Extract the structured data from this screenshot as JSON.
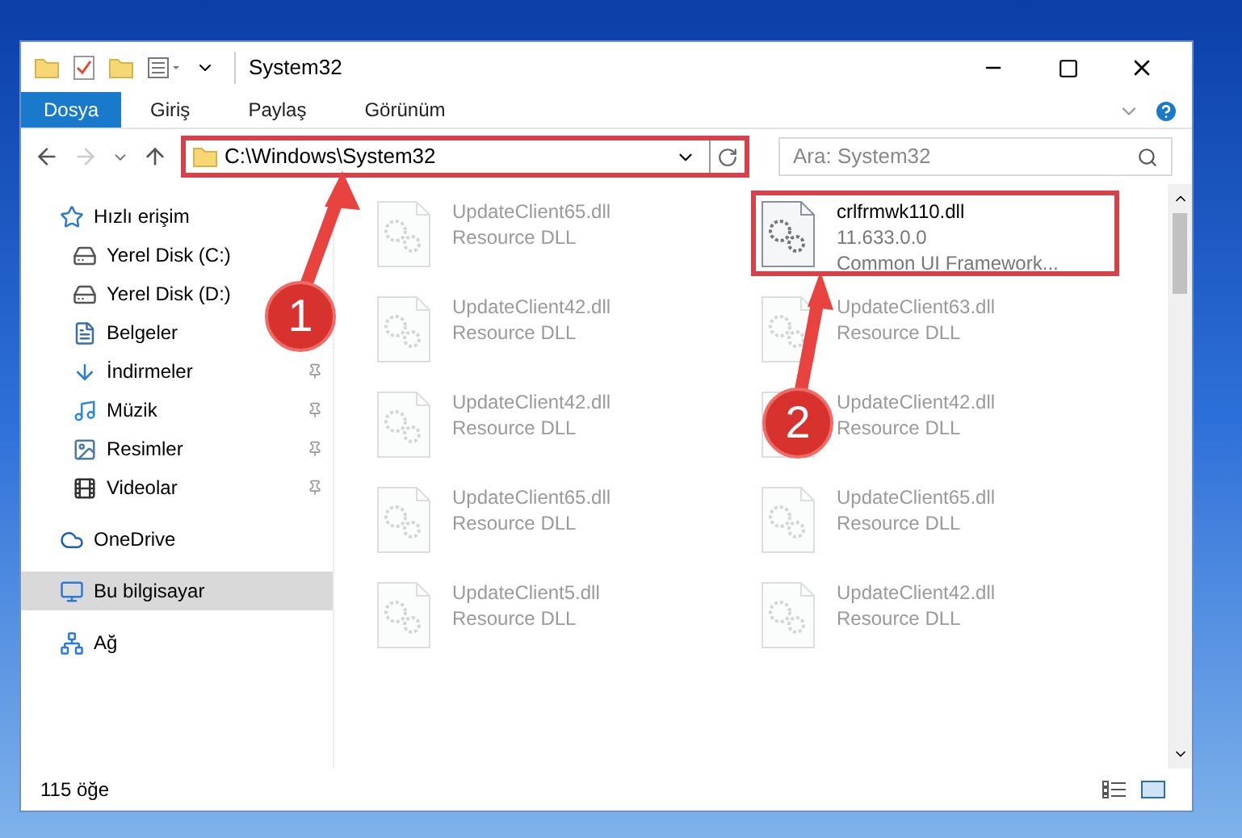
{
  "window": {
    "title": "System32"
  },
  "ribbon_tabs": [
    {
      "label": "Dosya",
      "selected": true
    },
    {
      "label": "Giriş",
      "selected": false
    },
    {
      "label": "Paylaş",
      "selected": false
    },
    {
      "label": "Görünüm",
      "selected": false
    }
  ],
  "address_bar": {
    "path": "C:\\Windows\\System32",
    "highlighted": true
  },
  "search": {
    "placeholder": "Ara: System32"
  },
  "sidebar": {
    "items": [
      {
        "label": "Hızlı erişim",
        "pinned": false,
        "selected": false,
        "kind": "group"
      },
      {
        "label": "Yerel Disk (C:)",
        "pinned": false,
        "selected": false,
        "kind": "child"
      },
      {
        "label": "Yerel Disk (D:)",
        "pinned": false,
        "selected": false,
        "kind": "child"
      },
      {
        "label": "Belgeler",
        "pinned": false,
        "selected": false,
        "kind": "child"
      },
      {
        "label": "İndirmeler",
        "pinned": true,
        "selected": false,
        "kind": "child"
      },
      {
        "label": "Müzik",
        "pinned": true,
        "selected": false,
        "kind": "child"
      },
      {
        "label": "Resimler",
        "pinned": true,
        "selected": false,
        "kind": "child"
      },
      {
        "label": "Videolar",
        "pinned": true,
        "selected": false,
        "kind": "child"
      },
      {
        "label": "OneDrive",
        "pinned": false,
        "selected": false,
        "kind": "group"
      },
      {
        "label": "Bu bilgisayar",
        "pinned": false,
        "selected": true,
        "kind": "group"
      },
      {
        "label": "Ağ",
        "pinned": false,
        "selected": false,
        "kind": "group"
      }
    ]
  },
  "files": [
    {
      "name": "UpdateClient65.dll",
      "lines": [
        "Resource DLL"
      ],
      "highlighted": false,
      "faded": true
    },
    {
      "name": "crlfrmwk110.dll",
      "lines": [
        "11.633.0.0",
        "Common UI Framework..."
      ],
      "highlighted": true,
      "faded": false
    },
    {
      "name": "UpdateClient42.dll",
      "lines": [
        "Resource DLL"
      ],
      "highlighted": false,
      "faded": true
    },
    {
      "name": "UpdateClient63.dll",
      "lines": [
        "Resource DLL"
      ],
      "highlighted": false,
      "faded": true
    },
    {
      "name": "UpdateClient42.dll",
      "lines": [
        "Resource DLL"
      ],
      "highlighted": false,
      "faded": true
    },
    {
      "name": "UpdateClient42.dll",
      "lines": [
        "Resource DLL"
      ],
      "highlighted": false,
      "faded": true
    },
    {
      "name": "UpdateClient65.dll",
      "lines": [
        "Resource DLL"
      ],
      "highlighted": false,
      "faded": true
    },
    {
      "name": "UpdateClient65.dll",
      "lines": [
        "Resource DLL"
      ],
      "highlighted": false,
      "faded": true
    },
    {
      "name": "UpdateClient5.dll",
      "lines": [
        "Resource DLL"
      ],
      "highlighted": false,
      "faded": true
    },
    {
      "name": "UpdateClient42.dll",
      "lines": [
        "Resource DLL"
      ],
      "highlighted": false,
      "faded": true
    }
  ],
  "annotations": [
    {
      "number": "1"
    },
    {
      "number": "2"
    }
  ],
  "status_bar": {
    "count": "115 öğe"
  }
}
